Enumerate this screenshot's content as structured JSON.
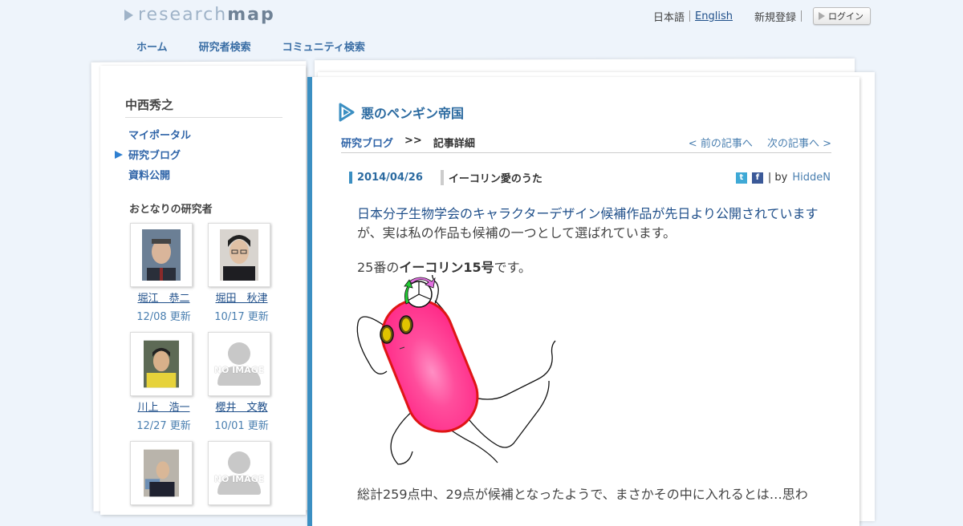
{
  "header": {
    "logo_light": "research",
    "logo_bold": "map",
    "lang_ja": "日本語",
    "lang_en": "English",
    "register": "新規登録",
    "login": "ログイン"
  },
  "nav": {
    "items": [
      "ホーム",
      "研究者検索",
      "コミュニティ検索"
    ]
  },
  "sidebar": {
    "user_name": "中西秀之",
    "menu": [
      "マイポータル",
      "研究ブログ",
      "資料公開"
    ],
    "active_index": 1,
    "neighbors_title": "おとなりの研究者",
    "no_image": "NO IMAGE",
    "neighbors": [
      {
        "name": "堀江　恭二",
        "date": "12/08 更新"
      },
      {
        "name": "堀田　秋津",
        "date": "10/17 更新"
      },
      {
        "name": "川上　浩一",
        "date": "12/27 更新"
      },
      {
        "name": "櫻井　文教",
        "date": "10/01 更新"
      }
    ]
  },
  "main": {
    "blog_title": "悪のペンギン帝国",
    "breadcrumb": {
      "blog": "研究ブログ",
      "sep": ">>",
      "current": "記事詳細"
    },
    "prev": "< 前の記事へ",
    "next": "次の記事へ >",
    "post": {
      "date": "2014/04/26",
      "title": "イーコリン愛のうた",
      "by_prefix": "| by",
      "author": "HiddeN",
      "link_text": "日本分子生物学会のキャラクターデザイン候補作品が先日より公開されています",
      "line1_rest": "が、実は私の作品も候補の一つとして選ばれています。",
      "line2_a": "25番の",
      "line2_b": "イーコリン15号",
      "line2_c": "です。",
      "line3": "総計259点中、29点が候補となったようで、まさかその中に入れるとは…思わ"
    }
  },
  "colors": {
    "accent": "#3b8fc2",
    "link": "#1f4f8a",
    "background": "#eef4fb"
  }
}
